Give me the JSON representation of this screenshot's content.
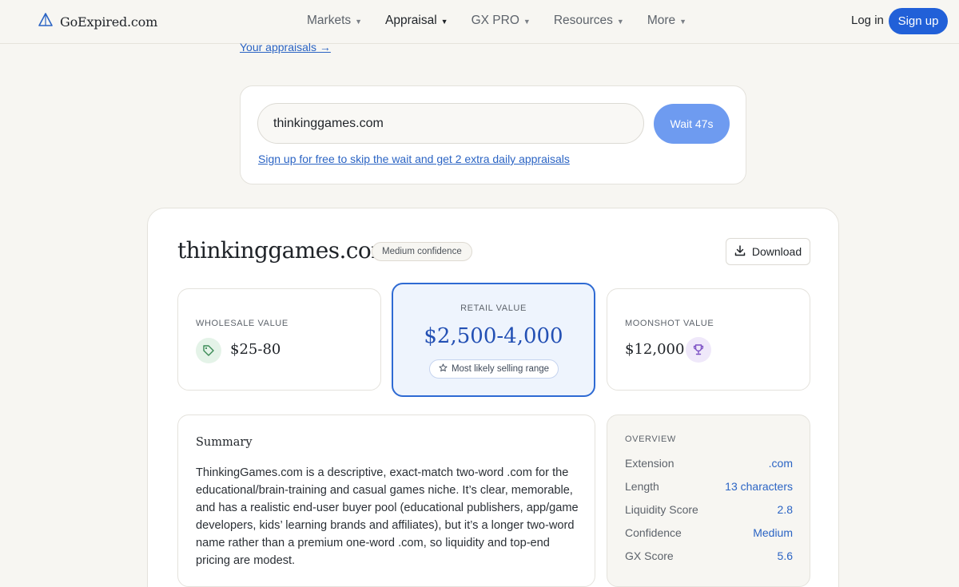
{
  "nav": {
    "brand": "GoExpired.com",
    "menu": [
      {
        "label": "Markets"
      },
      {
        "label": "Appraisal"
      },
      {
        "label": "GX PRO"
      },
      {
        "label": "Resources"
      },
      {
        "label": "More"
      }
    ],
    "login": "Log in",
    "signup": "Sign up",
    "accent_color": "#2160d8"
  },
  "your_appraisals": "Your appraisals →",
  "search": {
    "value": "thinkinggames.com",
    "wait_button": "Wait 47s",
    "skip_link": "Sign up for free to skip the wait and get 2 extra daily appraisals"
  },
  "result": {
    "domain": "thinkinggames.com",
    "confidence_badge": "Medium confidence",
    "download": "Download",
    "wholesale": {
      "label": "WHOLESALE VALUE",
      "amount": "$25-80",
      "icon": "tag-icon"
    },
    "retail": {
      "label": "RETAIL VALUE",
      "amount": "$2,500-4,000",
      "badge": "Most likely selling range",
      "icon": "star-icon"
    },
    "moonshot": {
      "label": "MOONSHOT VALUE",
      "amount": "$12,000",
      "icon": "trophy-icon"
    },
    "summary": {
      "title": "Summary",
      "text": "ThinkingGames.com is a descriptive, exact-match two-word .com for the educational/brain-training and casual games niche. It’s clear, memorable, and has a realistic end-user buyer pool (educational publishers, app/game developers, kids’ learning brands and affiliates), but it’s a longer two-word name rather than a premium one-word .com, so liquidity and top-end pricing are modest."
    },
    "overview": {
      "title": "OVERVIEW",
      "rows": [
        {
          "key": "Extension",
          "value": ".com"
        },
        {
          "key": "Length",
          "value": "13 characters"
        },
        {
          "key": "Liquidity Score",
          "value": "2.8"
        },
        {
          "key": "Confidence",
          "value": "Medium"
        },
        {
          "key": "GX Score",
          "value": "5.6"
        }
      ]
    }
  }
}
